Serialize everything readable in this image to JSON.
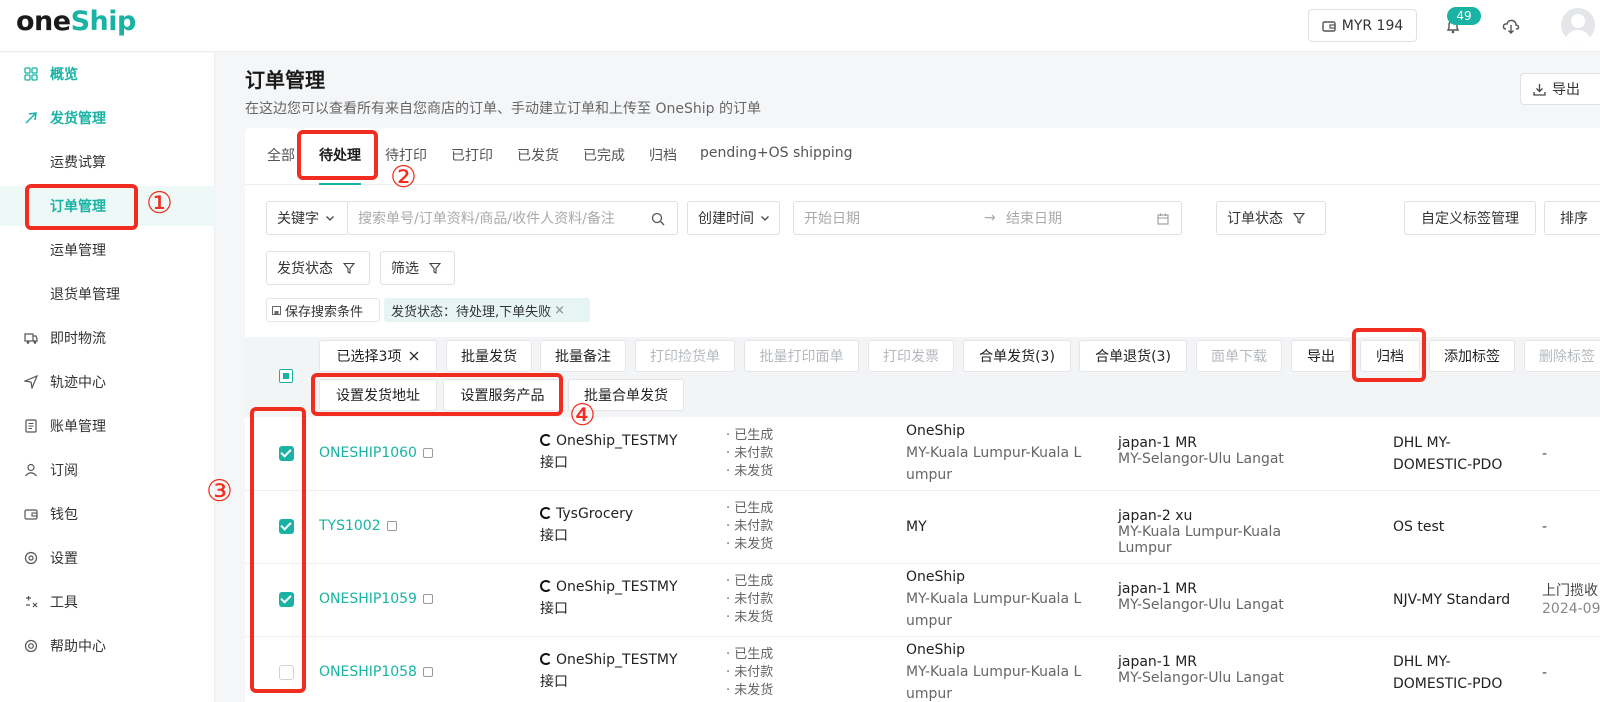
{
  "app": {
    "logo_one": "one",
    "logo_ship": "Ship",
    "wallet": "MYR 194",
    "notification_count": "49"
  },
  "sidebar": {
    "items": [
      {
        "label": "概览",
        "icon": "grid-icon"
      },
      {
        "label": "发货管理",
        "icon": "send-icon"
      },
      {
        "label": "运费试算",
        "icon": ""
      },
      {
        "label": "订单管理",
        "icon": ""
      },
      {
        "label": "运单管理",
        "icon": ""
      },
      {
        "label": "退货单管理",
        "icon": ""
      },
      {
        "label": "即时物流",
        "icon": "truck-icon"
      },
      {
        "label": "轨迹中心",
        "icon": "navigation-icon"
      },
      {
        "label": "账单管理",
        "icon": "bill-icon"
      },
      {
        "label": "订阅",
        "icon": "user-icon"
      },
      {
        "label": "钱包",
        "icon": "wallet-icon"
      },
      {
        "label": "设置",
        "icon": "settings-icon"
      },
      {
        "label": "工具",
        "icon": "tools-icon"
      },
      {
        "label": "帮助中心",
        "icon": "help-icon"
      }
    ]
  },
  "page": {
    "title": "订单管理",
    "description": "在这边您可以查看所有来自您商店的订单、手动建立订单和上传至 OneShip 的订单",
    "export_label": "导出"
  },
  "tabs": [
    "全部",
    "待处理",
    "待打印",
    "已打印",
    "已发货",
    "已完成",
    "归档",
    "pending+OS shipping"
  ],
  "filters": {
    "keyword_label": "关键字",
    "search_placeholder": "搜索单号/订单资料/商品/收件人资料/备注",
    "time_label": "创建时间",
    "start_placeholder": "开始日期",
    "end_placeholder": "结束日期",
    "order_status_label": "订单状态",
    "custom_tag_label": "自定义标签管理",
    "sort_label": "排序",
    "ship_status_label": "发货状态",
    "filter_label": "筛选",
    "save_search_label": "保存搜索条件",
    "active_chip": "发货状态：待处理,下单失败"
  },
  "bulk": {
    "selected_label": "已选择3项",
    "buttons_row1": [
      {
        "label": "批量发货",
        "disabled": false
      },
      {
        "label": "批量备注",
        "disabled": false
      },
      {
        "label": "打印捡货单",
        "disabled": true
      },
      {
        "label": "批量打印面单",
        "disabled": true
      },
      {
        "label": "打印发票",
        "disabled": true
      },
      {
        "label": "合单发货(3)",
        "disabled": false
      },
      {
        "label": "合单退货(3)",
        "disabled": false
      },
      {
        "label": "面单下载",
        "disabled": true
      },
      {
        "label": "导出",
        "disabled": false
      },
      {
        "label": "归档",
        "disabled": false
      },
      {
        "label": "添加标签",
        "disabled": false
      },
      {
        "label": "删除标签",
        "disabled": true
      }
    ],
    "buttons_row2": [
      {
        "label": "设置发货地址"
      },
      {
        "label": "设置服务产品"
      },
      {
        "label": "批量合单发货"
      }
    ]
  },
  "orders": [
    {
      "checked": true,
      "order_no": "ONESHIP1060",
      "store": "OneShip_TESTMY",
      "store_sub": "接口",
      "status": [
        "· 已生成",
        "· 未付款",
        "· 未发货"
      ],
      "sender": [
        "OneShip",
        "MY-Kuala Lumpur-Kuala L",
        "umpur"
      ],
      "receiver_name": "japan-1 MR",
      "receiver_addr": [
        "MY-Selangor-Ulu Langat"
      ],
      "service": [
        "DHL MY-",
        "DOMESTIC-PDO"
      ],
      "extra": [
        "-"
      ]
    },
    {
      "checked": true,
      "order_no": "TYS1002",
      "store": "TysGrocery",
      "store_sub": "接口",
      "status": [
        "· 已生成",
        "· 未付款",
        "· 未发货"
      ],
      "sender": [
        "MY"
      ],
      "receiver_name": "japan-2 xu",
      "receiver_addr": [
        "MY-Kuala Lumpur-Kuala",
        "Lumpur"
      ],
      "service": [
        "OS test"
      ],
      "extra": [
        "-"
      ]
    },
    {
      "checked": true,
      "order_no": "ONESHIP1059",
      "store": "OneShip_TESTMY",
      "store_sub": "接口",
      "status": [
        "· 已生成",
        "· 未付款",
        "· 未发货"
      ],
      "sender": [
        "OneShip",
        "MY-Kuala Lumpur-Kuala L",
        "umpur"
      ],
      "receiver_name": "japan-1 MR",
      "receiver_addr": [
        "MY-Selangor-Ulu Langat"
      ],
      "service": [
        "NJV-MY Standard"
      ],
      "extra": [
        "上门揽收",
        "2024-09"
      ]
    },
    {
      "checked": false,
      "order_no": "ONESHIP1058",
      "store": "OneShip_TESTMY",
      "store_sub": "接口",
      "status": [
        "· 已生成",
        "· 未付款",
        "· 未发货"
      ],
      "sender": [
        "OneShip",
        "MY-Kuala Lumpur-Kuala L",
        "umpur"
      ],
      "receiver_name": "japan-1 MR",
      "receiver_addr": [
        "MY-Selangor-Ulu Langat"
      ],
      "service": [
        "DHL MY-",
        "DOMESTIC-PDO"
      ],
      "extra": [
        "-"
      ]
    }
  ],
  "annotations": [
    "①",
    "②",
    "③",
    "④"
  ],
  "colors": {
    "accent": "#19b3a4",
    "annotation": "#f02d1f"
  }
}
